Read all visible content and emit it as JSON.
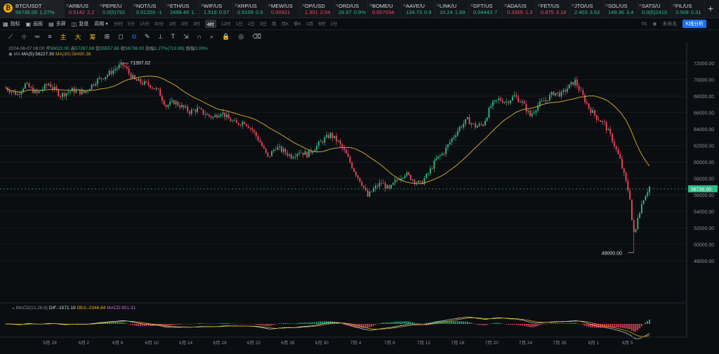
{
  "tickers": [
    {
      "sym": "BTC/USDT",
      "price": "56736.00",
      "chg": "1.27%",
      "dir": "up",
      "active": true
    },
    {
      "sym": "ARB/US",
      "price": "0.5142",
      "chg": "2.2",
      "dir": "down"
    },
    {
      "sym": "PEPE/U",
      "price": "0.0(5)792",
      "chg": "",
      "dir": "up"
    },
    {
      "sym": "NOT/US",
      "price": "0.01203",
      "chg": "-1",
      "dir": "up"
    },
    {
      "sym": "ETH/US",
      "price": "2498.49",
      "chg": "1.",
      "dir": "up"
    },
    {
      "sym": "WIF/US",
      "price": "1.518",
      "chg": "0.57",
      "dir": "up"
    },
    {
      "sym": "XRP/US",
      "price": "0.5109",
      "chg": "0.9",
      "dir": "up"
    },
    {
      "sym": "MEW/US",
      "price": "0.00921",
      "chg": "",
      "dir": "down"
    },
    {
      "sym": "OP/USD",
      "price": "1.301",
      "chg": "2.04",
      "dir": "down"
    },
    {
      "sym": "ORD/US",
      "price": "26.97",
      "chg": "0.9%",
      "dir": "up"
    },
    {
      "sym": "BOME/U",
      "price": "0.007034",
      "chg": "",
      "dir": "down"
    },
    {
      "sym": "AAVE/U",
      "price": "134.73",
      "chg": "0.9",
      "dir": "up"
    },
    {
      "sym": "LINK/U",
      "price": "10.24",
      "chg": "1.69",
      "dir": "up"
    },
    {
      "sym": "GFT/US",
      "price": "0.04443",
      "chg": "7",
      "dir": "up"
    },
    {
      "sym": "ADA/US",
      "price": "0.3355",
      "chg": "1.3",
      "dir": "down"
    },
    {
      "sym": "FET/US",
      "price": "0.875",
      "chg": "3.18",
      "dir": "down"
    },
    {
      "sym": "JTO/US",
      "price": "2.403",
      "chg": "3.62",
      "dir": "up"
    },
    {
      "sym": "SOL/US",
      "price": "149.36",
      "chg": "3.4",
      "dir": "up"
    },
    {
      "sym": "SATS/U",
      "price": "0.0(6)2410",
      "chg": "",
      "dir": "up"
    },
    {
      "sym": "FIL/US",
      "price": "3.508",
      "chg": "0.31",
      "dir": "up"
    }
  ],
  "toolbar": {
    "indicator": "指标",
    "layout": "画板",
    "multi": "多屏",
    "replay": "复盘",
    "period": "周期",
    "intervals": [
      "分时",
      "5分",
      "15分",
      "30分",
      "1时",
      "2时",
      "3时",
      "4时",
      "12时",
      "1日",
      "2日",
      "3日",
      "周",
      "月K",
      "季K",
      "3月",
      "6时",
      "1分"
    ],
    "selected_interval": "4时",
    "right_items": [
      "0s",
      "未命名",
      "K线分析"
    ]
  },
  "draw_tools": [
    "主",
    "大",
    "筹"
  ],
  "info": {
    "date": "2024-08-07 08:00",
    "open_label": "开",
    "open": "56022.00",
    "high_label": "高",
    "high": "57287.99",
    "low_label": "低",
    "low": "55557.88",
    "close_label": "收",
    "close": "56736.00",
    "range_label": "涨幅",
    "range": "1.27%(713.99)",
    "amp_label": "振幅",
    "amp": "3.09%",
    "ma_label": "MA",
    "ma5": "MA(5):56227.90",
    "ma30": "MA(30):58490.38"
  },
  "macd": {
    "label": "MACD(12,26,9)",
    "dif": "DIF:-1571.19",
    "dea": "DEA:-2346.84",
    "macd": "MACD:951.31"
  },
  "colors": {
    "up": "#2ebd85",
    "down": "#f6465d",
    "ma5": "#d9d9d9",
    "ma30": "#c9a227",
    "bg": "#0b0e11"
  },
  "chart_data": {
    "type": "candlestick",
    "y_ticks": [
      "72000.00",
      "70000.00",
      "68000.00",
      "66000.00",
      "64000.00",
      "62000.00",
      "60000.00",
      "58000.00",
      "56000.00",
      "54000.00",
      "52000.00",
      "50000.00",
      "48000.00"
    ],
    "ylim": [
      47200,
      73200
    ],
    "x_ticks": [
      "5月 29",
      "6月 2",
      "6月 6",
      "6月 10",
      "6月 14",
      "6月 18",
      "6月 22",
      "6月 26",
      "6月 30",
      "7月 4",
      "7月 8",
      "7月 12",
      "7月 16",
      "7月 20",
      "7月 24",
      "7月 28",
      "8月 1",
      "8月 5"
    ],
    "annotations": {
      "high": "71997.02",
      "low": "49000.00",
      "last": "56736.00"
    },
    "price_path": [
      [
        0,
        69000
      ],
      [
        6,
        68200
      ],
      [
        10,
        69400
      ],
      [
        16,
        68300
      ],
      [
        22,
        69500
      ],
      [
        28,
        68100
      ],
      [
        34,
        68700
      ],
      [
        40,
        68400
      ],
      [
        46,
        69800
      ],
      [
        52,
        70600
      ],
      [
        56,
        71300
      ],
      [
        60,
        71900
      ],
      [
        63,
        70800
      ],
      [
        66,
        69900
      ],
      [
        70,
        69600
      ],
      [
        74,
        69300
      ],
      [
        78,
        68600
      ],
      [
        82,
        66800
      ],
      [
        86,
        67300
      ],
      [
        90,
        66700
      ],
      [
        94,
        66100
      ],
      [
        98,
        66400
      ],
      [
        102,
        65800
      ],
      [
        106,
        65400
      ],
      [
        110,
        66100
      ],
      [
        114,
        65200
      ],
      [
        118,
        64600
      ],
      [
        122,
        64900
      ],
      [
        126,
        63900
      ],
      [
        130,
        62400
      ],
      [
        134,
        60500
      ],
      [
        138,
        61800
      ],
      [
        142,
        61300
      ],
      [
        146,
        60700
      ],
      [
        150,
        61300
      ],
      [
        154,
        60900
      ],
      [
        158,
        61700
      ],
      [
        162,
        62600
      ],
      [
        166,
        63300
      ],
      [
        170,
        62400
      ],
      [
        174,
        60900
      ],
      [
        178,
        59000
      ],
      [
        182,
        57400
      ],
      [
        185,
        55800
      ],
      [
        188,
        56700
      ],
      [
        192,
        57500
      ],
      [
        196,
        56600
      ],
      [
        200,
        57900
      ],
      [
        204,
        58600
      ],
      [
        208,
        57900
      ],
      [
        212,
        57300
      ],
      [
        216,
        58600
      ],
      [
        220,
        60300
      ],
      [
        224,
        61200
      ],
      [
        228,
        62800
      ],
      [
        232,
        64200
      ],
      [
        236,
        65100
      ],
      [
        240,
        64300
      ],
      [
        244,
        64600
      ],
      [
        248,
        66800
      ],
      [
        252,
        67600
      ],
      [
        256,
        67300
      ],
      [
        260,
        68000
      ],
      [
        264,
        67200
      ],
      [
        268,
        65600
      ],
      [
        272,
        66900
      ],
      [
        276,
        67500
      ],
      [
        280,
        68400
      ],
      [
        284,
        68200
      ],
      [
        288,
        69200
      ],
      [
        291,
        69800
      ],
      [
        294,
        68400
      ],
      [
        298,
        66600
      ],
      [
        302,
        65400
      ],
      [
        306,
        64600
      ],
      [
        310,
        62700
      ],
      [
        314,
        60200
      ],
      [
        317,
        57500
      ],
      [
        319,
        55700
      ],
      [
        321,
        50200
      ],
      [
        323,
        53400
      ],
      [
        326,
        55600
      ],
      [
        329,
        57000
      ]
    ]
  }
}
